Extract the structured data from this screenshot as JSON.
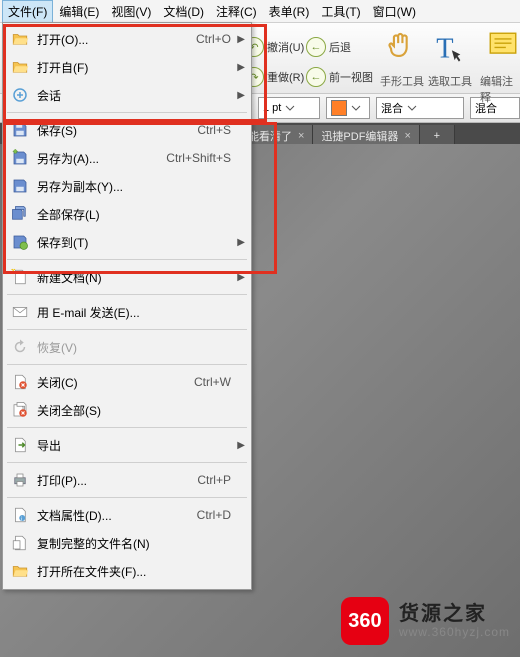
{
  "menubar": {
    "items": [
      {
        "label": "文件(F)",
        "active": true
      },
      {
        "label": "编辑(E)"
      },
      {
        "label": "视图(V)"
      },
      {
        "label": "文档(D)"
      },
      {
        "label": "注释(C)"
      },
      {
        "label": "表单(R)"
      },
      {
        "label": "工具(T)"
      },
      {
        "label": "窗口(W)"
      }
    ]
  },
  "ribbon": {
    "undo": "撤消(U)",
    "redo": "重做(R)",
    "back": "后退",
    "prev": "前一视图",
    "hand": "手形工具",
    "select": "选取工具",
    "edit_anno": "编辑注释"
  },
  "toolbar2": {
    "stroke": "1 pt",
    "color": "#ff7f27",
    "blend1": "混合",
    "blend2": "混合"
  },
  "tabs": [
    {
      "label": "能看清了"
    },
    {
      "label": "迅捷PDF编辑器"
    }
  ],
  "menu": {
    "items": [
      {
        "icon": "folder-open",
        "label": "打开(O)...",
        "shortcut": "Ctrl+O",
        "sub": true
      },
      {
        "icon": "folder-open",
        "label": "打开自(F)",
        "sub": true
      },
      {
        "icon": "session",
        "label": "会话",
        "sub": true,
        "sep_after": true
      },
      {
        "icon": "save",
        "label": "保存(S)",
        "shortcut": "Ctrl+S"
      },
      {
        "icon": "save-as",
        "label": "另存为(A)...",
        "shortcut": "Ctrl+Shift+S"
      },
      {
        "icon": "save-copy",
        "label": "另存为副本(Y)..."
      },
      {
        "icon": "save-all",
        "label": "全部保存(L)"
      },
      {
        "icon": "save-to",
        "label": "保存到(T)",
        "sub": true,
        "sep_after": true
      },
      {
        "icon": "new-doc",
        "label": "新建文档(N)",
        "sub": true,
        "sep_after": true
      },
      {
        "icon": "email",
        "label": "用 E-mail 发送(E)...",
        "sep_after": true
      },
      {
        "icon": "revert",
        "label": "恢复(V)",
        "disabled": true,
        "sep_after": true
      },
      {
        "icon": "close",
        "label": "关闭(C)",
        "shortcut": "Ctrl+W"
      },
      {
        "icon": "close-all",
        "label": "关闭全部(S)",
        "sep_after": true
      },
      {
        "icon": "export",
        "label": "导出",
        "sub": true,
        "sep_after": true
      },
      {
        "icon": "print",
        "label": "打印(P)...",
        "shortcut": "Ctrl+P",
        "sep_after": true
      },
      {
        "icon": "properties",
        "label": "文档属性(D)...",
        "shortcut": "Ctrl+D"
      },
      {
        "icon": "copy-name",
        "label": "复制完整的文件名(N)"
      },
      {
        "icon": "open-folder",
        "label": "打开所在文件夹(F)..."
      }
    ]
  },
  "watermark": {
    "badge": "360",
    "title": "货源之家",
    "url": "www.360hyzj.com"
  }
}
